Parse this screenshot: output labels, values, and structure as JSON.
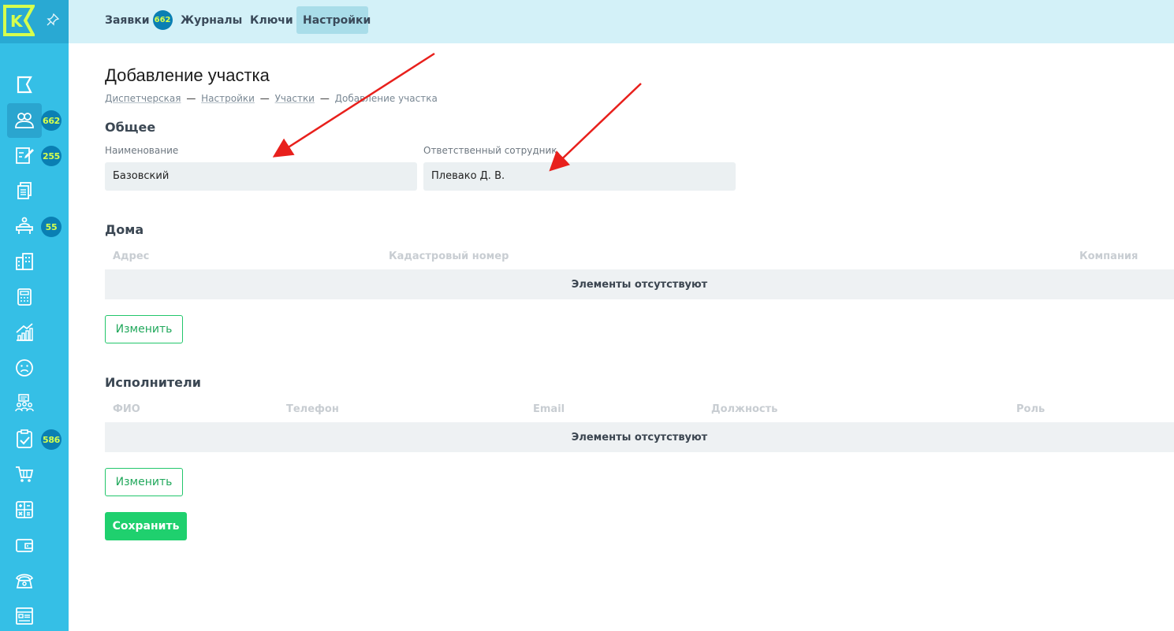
{
  "sidebar": {
    "logo_letter": "K",
    "badges": {
      "users": "662",
      "edit": "255",
      "desk": "55",
      "tasks": "586"
    }
  },
  "topbar": {
    "tabs": [
      {
        "label": "Заявки",
        "badge": "662"
      },
      {
        "label": "Журналы"
      },
      {
        "label": "Ключи"
      },
      {
        "label": "Настройки",
        "active": true
      }
    ]
  },
  "page": {
    "title": "Добавление участка",
    "breadcrumb": [
      "Диспетчерская",
      "Настройки",
      "Участки",
      "Добавление участка"
    ],
    "breadcrumb_sep": "—"
  },
  "general": {
    "title": "Общее",
    "name_label": "Наименование",
    "name_value": "Базовский",
    "responsible_label": "Ответственный сотрудник",
    "responsible_value": "Плевако Д. В."
  },
  "houses": {
    "title": "Дома",
    "columns": [
      "Адрес",
      "Кадастровый номер",
      "Компания"
    ],
    "empty_text": "Элементы отсутствуют",
    "edit_label": "Изменить"
  },
  "executors": {
    "title": "Исполнители",
    "columns": [
      "ФИО",
      "Телефон",
      "Email",
      "Должность",
      "Роль"
    ],
    "empty_text": "Элементы отсутствуют",
    "edit_label": "Изменить"
  },
  "save_label": "Сохранить",
  "colors": {
    "sidebar": "#35bfe6",
    "topbar": "#d3f1f8",
    "badge": "#0a7fb3",
    "badge_text": "#d6ff4d",
    "accent_green": "#1fd06e",
    "annotation_arrow": "#e8201c"
  }
}
